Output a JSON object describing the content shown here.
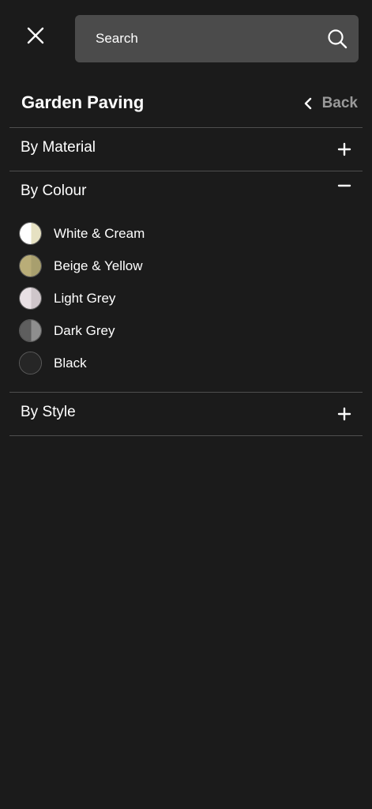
{
  "search": {
    "placeholder": "Search"
  },
  "header": {
    "title": "Garden Paving",
    "back_label": "Back"
  },
  "sections": [
    {
      "label": "By Material",
      "expanded": false,
      "toggle": "plus-icon"
    },
    {
      "label": "By Colour",
      "expanded": true,
      "toggle": "minus-icon"
    },
    {
      "label": "By Style",
      "expanded": false,
      "toggle": "plus-icon"
    }
  ],
  "colours": [
    {
      "label": "White & Cream",
      "left": "#ffffff",
      "right": "#e6e1c2"
    },
    {
      "label": "Beige & Yellow",
      "left": "#b9ad78",
      "right": "#a89f6e"
    },
    {
      "label": "Light Grey",
      "left": "#e8e0e4",
      "right": "#cfc6ca"
    },
    {
      "label": "Dark Grey",
      "left": "#5e5e5e",
      "right": "#8e8e8e"
    },
    {
      "label": "Black",
      "left": "#262626",
      "right": "#262626"
    }
  ],
  "colors": {
    "background": "#1b1b1b",
    "search_bg": "#4b4b4b",
    "divider": "#4e4e4e",
    "back_text": "#9a9a9a"
  }
}
